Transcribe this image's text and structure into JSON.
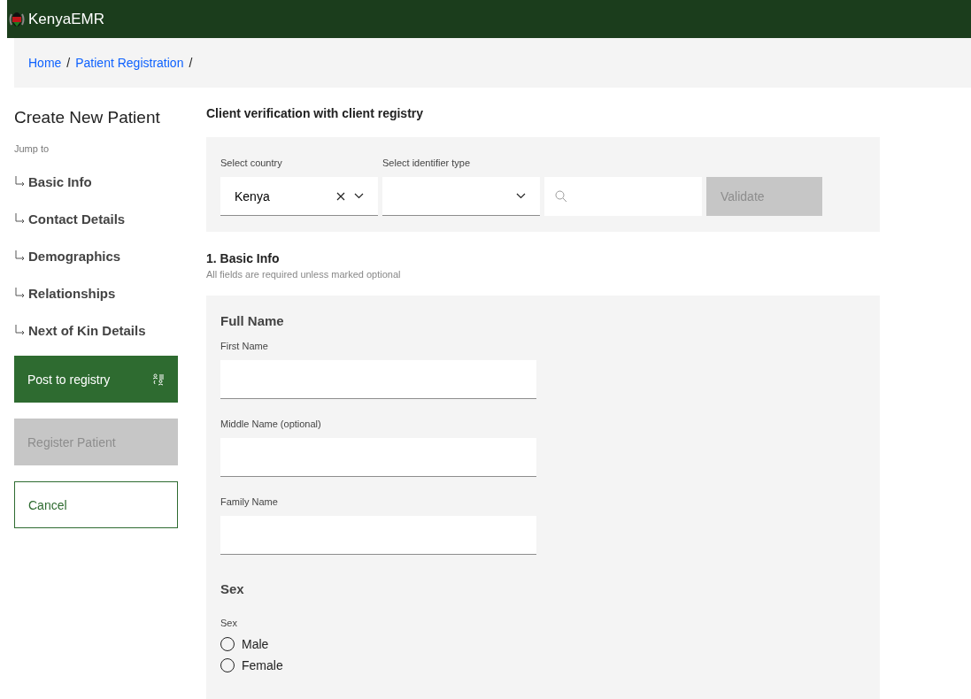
{
  "header": {
    "title": "KenyaEMR"
  },
  "breadcrumbs": [
    {
      "label": "Home",
      "separator": "/"
    },
    {
      "label": "Patient Registration",
      "separator": "/"
    }
  ],
  "sidebar": {
    "title": "Create New Patient",
    "jump_label": "Jump to",
    "items": [
      {
        "label": "Basic Info"
      },
      {
        "label": "Contact Details"
      },
      {
        "label": "Demographics"
      },
      {
        "label": "Relationships"
      },
      {
        "label": "Next of Kin Details"
      }
    ],
    "buttons": [
      {
        "label": "Post to registry",
        "kind": "primary",
        "disabled": false
      },
      {
        "label": "Register Patient",
        "kind": "primary",
        "disabled": true
      },
      {
        "label": "Cancel",
        "kind": "outline",
        "disabled": false
      }
    ]
  },
  "verification": {
    "title": "Client verification with client registry",
    "country_label": "Select country",
    "country_value": "Kenya",
    "identifier_label": "Select identifier type",
    "validate": {
      "label": "Validate",
      "disabled": true
    }
  },
  "basic_info": {
    "title": "1. Basic Info",
    "note": "All fields are required unless marked optional",
    "group_title": "Full Name",
    "fields": [
      {
        "label": "First Name"
      },
      {
        "label": "Middle Name (optional)"
      },
      {
        "label": "Family Name"
      }
    ],
    "sex_title": "Sex",
    "sex_label": "Sex",
    "sex_options": [
      {
        "label": "Male",
        "selected": false
      },
      {
        "label": "Female",
        "selected": false
      }
    ]
  }
}
